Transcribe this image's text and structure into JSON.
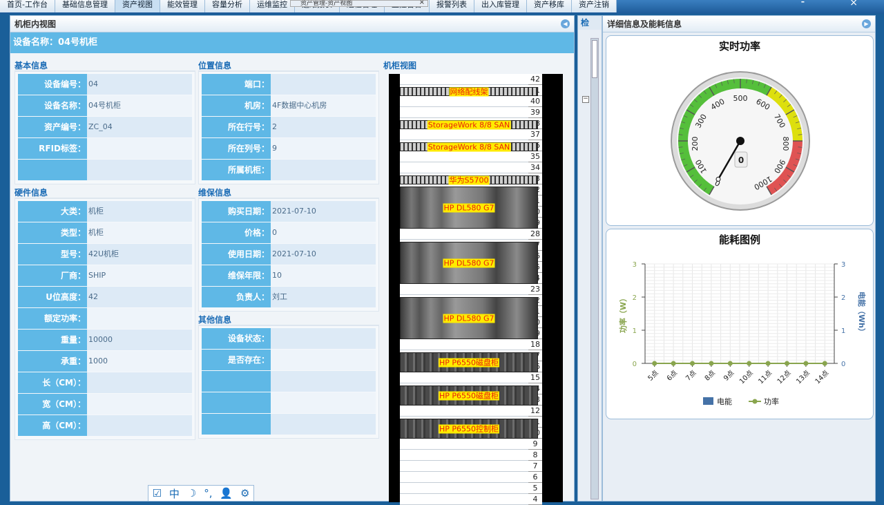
{
  "top_tabs": [
    "首页-工作台",
    "基础信息管理",
    "资产视图",
    "能效管理",
    "容量分析",
    "运维监控",
    "运维报表",
    "巡检管理",
    "监控告警",
    "报警列表",
    "出入库管理",
    "资产移库",
    "资产注销"
  ],
  "browser_tab": {
    "label": "资产管理-资产视图",
    "url": "http://localhost/Scebd/Assets/Manage/Assets"
  },
  "left_panel": {
    "title": "机柜内视图",
    "device_name": "设备名称：04号机柜",
    "basic": {
      "title": "基本信息",
      "rows": [
        {
          "label": "设备编号：",
          "value": "04"
        },
        {
          "label": "设备名称：",
          "value": "04号机柜"
        },
        {
          "label": "资产编号：",
          "value": "ZC_04"
        },
        {
          "label": "RFID标签：",
          "value": ""
        },
        {
          "label": "",
          "value": ""
        }
      ]
    },
    "location": {
      "title": "位置信息",
      "rows": [
        {
          "label": "端口：",
          "value": ""
        },
        {
          "label": "机房：",
          "value": "4F数据中心机房"
        },
        {
          "label": "所在行号：",
          "value": "2"
        },
        {
          "label": "所在列号：",
          "value": "9"
        },
        {
          "label": "所属机柜：",
          "value": ""
        }
      ]
    },
    "hardware": {
      "title": "硬件信息",
      "rows": [
        {
          "label": "大类：",
          "value": "机柜"
        },
        {
          "label": "类型：",
          "value": "机柜"
        },
        {
          "label": "型号：",
          "value": "42U机柜"
        },
        {
          "label": "厂商：",
          "value": "SHIP"
        },
        {
          "label": "U位高度：",
          "value": "42"
        },
        {
          "label": "额定功率：",
          "value": ""
        },
        {
          "label": "重量：",
          "value": "10000"
        },
        {
          "label": "承重：",
          "value": "1000"
        },
        {
          "label": "长（CM）：",
          "value": ""
        },
        {
          "label": "宽（CM）：",
          "value": ""
        },
        {
          "label": "高（CM）：",
          "value": ""
        }
      ]
    },
    "maintenance": {
      "title": "维保信息",
      "rows": [
        {
          "label": "购买日期：",
          "value": "2021-07-10"
        },
        {
          "label": "价格：",
          "value": "0"
        },
        {
          "label": "使用日期：",
          "value": "2021-07-10"
        },
        {
          "label": "维保年限：",
          "value": "10"
        },
        {
          "label": "负责人：",
          "value": "刘工"
        }
      ]
    },
    "other": {
      "title": "其他信息",
      "rows": [
        {
          "label": "设备状态：",
          "value": ""
        },
        {
          "label": "是否存在：",
          "value": ""
        },
        {
          "label": "",
          "value": ""
        },
        {
          "label": "",
          "value": ""
        },
        {
          "label": "",
          "value": ""
        }
      ]
    },
    "rack": {
      "title": "机柜视图",
      "u_max": 42,
      "u_min": 4,
      "devices": [
        {
          "name": "网络配线架",
          "top_u": 41,
          "height_u": 1,
          "kind": "net"
        },
        {
          "name": "StorageWork 8/8 SAN",
          "top_u": 38,
          "height_u": 1,
          "kind": "net"
        },
        {
          "name": "StorageWork 8/8 SAN",
          "top_u": 36,
          "height_u": 1,
          "kind": "net"
        },
        {
          "name": "华为S5700",
          "top_u": 33,
          "height_u": 1,
          "kind": "net"
        },
        {
          "name": "HP DL580 G7",
          "top_u": 32,
          "height_u": 4,
          "kind": "server"
        },
        {
          "name": "HP DL580 G7",
          "top_u": 27,
          "height_u": 4,
          "kind": "server"
        },
        {
          "name": "HP DL580 G7",
          "top_u": 22,
          "height_u": 4,
          "kind": "server"
        },
        {
          "name": "HP P6550磁盘柜",
          "top_u": 17,
          "height_u": 2,
          "kind": "disk"
        },
        {
          "name": "HP P6550磁盘柜",
          "top_u": 14,
          "height_u": 2,
          "kind": "disk"
        },
        {
          "name": "HP P6550控制柜",
          "top_u": 11,
          "height_u": 2,
          "kind": "disk"
        }
      ]
    }
  },
  "mid_strip": {
    "title": "检"
  },
  "right_panel": {
    "title": "详细信息及能耗信息",
    "gauge": {
      "title": "实时功率",
      "value": 0,
      "readout": "0",
      "min": 0,
      "max": 1000,
      "ticks": [
        "0",
        "100",
        "200",
        "300",
        "400",
        "500",
        "600",
        "700",
        "800",
        "900",
        "1000"
      ],
      "colors": {
        "green": "#55bf3b",
        "yellow": "#dddf0d",
        "red": "#df5353"
      }
    },
    "chart_data": {
      "type": "line",
      "title": "能耗图例",
      "categories": [
        "5点",
        "6点",
        "7点",
        "8点",
        "9点",
        "10点",
        "11点",
        "12点",
        "13点",
        "14点"
      ],
      "series": [
        {
          "name": "电能",
          "values": [
            0,
            0,
            0,
            0,
            0,
            0,
            0,
            0,
            0,
            0
          ],
          "color": "#4572a7",
          "axis": "right"
        },
        {
          "name": "功率",
          "values": [
            0,
            0,
            0,
            0,
            0,
            0,
            0,
            0,
            0,
            0
          ],
          "color": "#89a54e",
          "axis": "left"
        }
      ],
      "ylabel": "功率（W）",
      "ylabel_right": "电能（Wh）",
      "ylim": [
        0,
        3
      ],
      "yticks": [
        "0",
        "1",
        "2",
        "3"
      ],
      "legend": "bottom"
    }
  },
  "toolbar": {
    "icons": [
      "check-icon",
      "chinese-input-icon",
      "moon-icon",
      "punctuation-icon",
      "user-icon",
      "gear-icon"
    ],
    "glyphs": [
      "☑",
      "中",
      "☽",
      "°,",
      "👤",
      "⚙"
    ]
  }
}
